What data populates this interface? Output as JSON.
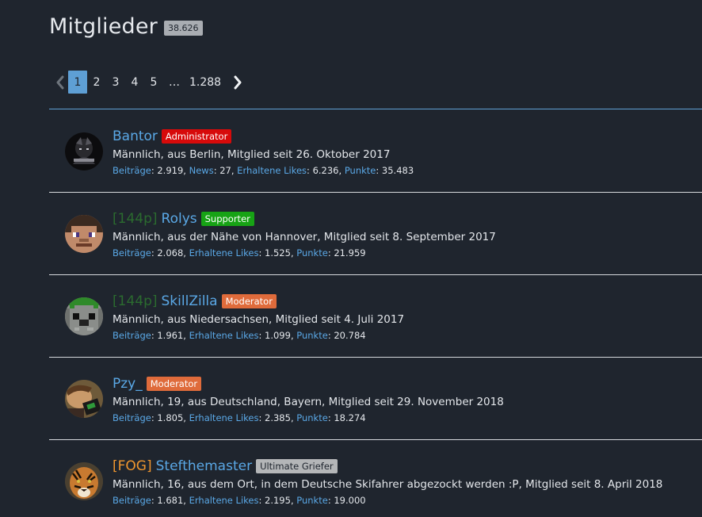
{
  "header": {
    "title": "Mitglieder",
    "count": "38.626"
  },
  "pagination": {
    "pages": [
      "1",
      "2",
      "3",
      "4",
      "5"
    ],
    "ellipsis": "…",
    "last": "1.288",
    "current": "1"
  },
  "colors": {
    "background": "#1f252e",
    "link": "#5aa8e6",
    "accent": "#5e9fd5",
    "admin": "#d70a0a",
    "supporter": "#17a315",
    "moderator": "#df6b3b",
    "griefer": "#b4b6b8"
  },
  "members": [
    {
      "prefix": "",
      "name": "Bantor",
      "badge": "Administrator",
      "bio": "Männlich, aus Berlin, Mitglied seit 26. Oktober 2017",
      "stats": [
        {
          "label": "Beiträge",
          "value": "2.919"
        },
        {
          "label": "News",
          "value": "27"
        },
        {
          "label": "Erhaltene Likes",
          "value": "6.236"
        },
        {
          "label": "Punkte",
          "value": "35.483"
        }
      ]
    },
    {
      "prefix": "[144p]",
      "name": "Rolys",
      "badge": "Supporter",
      "bio": "Männlich, aus der Nähe von Hannover, Mitglied seit 8. September 2017",
      "stats": [
        {
          "label": "Beiträge",
          "value": "2.068"
        },
        {
          "label": "Erhaltene Likes",
          "value": "1.525"
        },
        {
          "label": "Punkte",
          "value": "21.959"
        }
      ]
    },
    {
      "prefix": "[144p]",
      "name": "SkillZilla",
      "badge": "Moderator",
      "bio": "Männlich, aus Niedersachsen, Mitglied seit 4. Juli 2017",
      "stats": [
        {
          "label": "Beiträge",
          "value": "1.961"
        },
        {
          "label": "Erhaltene Likes",
          "value": "1.099"
        },
        {
          "label": "Punkte",
          "value": "20.784"
        }
      ]
    },
    {
      "prefix": "",
      "name": "Pzy_",
      "badge": "Moderator",
      "bio": "Männlich, 19, aus Deutschland, Bayern, Mitglied seit 29. November 2018",
      "stats": [
        {
          "label": "Beiträge",
          "value": "1.805"
        },
        {
          "label": "Erhaltene Likes",
          "value": "2.385"
        },
        {
          "label": "Punkte",
          "value": "18.274"
        }
      ]
    },
    {
      "prefix": "[FOG]",
      "name": "Stefthemaster",
      "badge": "Ultimate Griefer",
      "bio": "Männlich, 16, aus dem Ort, in dem Deutsche Skifahrer abgezockt werden :P, Mitglied seit 8. April 2018",
      "stats": [
        {
          "label": "Beiträge",
          "value": "1.681"
        },
        {
          "label": "Erhaltene Likes",
          "value": "2.195"
        },
        {
          "label": "Punkte",
          "value": "19.000"
        }
      ]
    }
  ]
}
